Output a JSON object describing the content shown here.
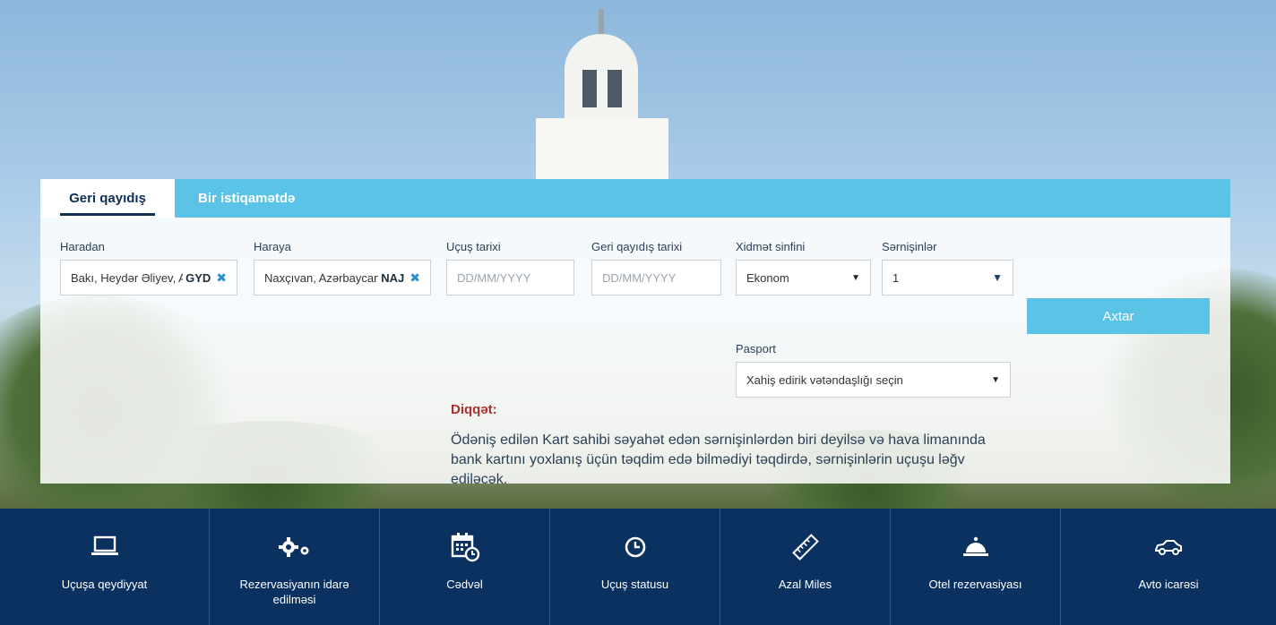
{
  "tabs": {
    "round_trip": "Geri qayıdış",
    "one_way": "Bir istiqamətdə"
  },
  "form": {
    "from": {
      "label": "Haradan",
      "value": "Bakı, Heydər Əliyev, A",
      "code": "GYD"
    },
    "to": {
      "label": "Haraya",
      "value": "Naxçıvan, Azərbaycan",
      "code": "NAJ"
    },
    "departure_date": {
      "label": "Uçuş tarixi",
      "placeholder": "DD/MM/YYYY"
    },
    "return_date": {
      "label": "Geri qayıdış tarixi",
      "placeholder": "DD/MM/YYYY"
    },
    "service_class": {
      "label": "Xidmət sinfini",
      "value": "Ekonom"
    },
    "passengers": {
      "label": "Sərnişinlər",
      "value": "1"
    },
    "search_button": "Axtar",
    "passport": {
      "label": "Pasport",
      "value": "Xahiş edirik vətəndaşlığı seçin"
    }
  },
  "notice": {
    "title": "Diqqət:",
    "text": "Ödəniş edilən Kart sahibi səyahət edən sərnişinlərdən biri deyilsə və hava limanında bank kartını yoxlanış üçün təqdim edə bilmədiyi təqdirdə, sərnişinlərin uçuşu ləğv ediləcək."
  },
  "nav": [
    {
      "label": "Uçuşa qeydiyyat",
      "icon": "laptop-icon"
    },
    {
      "label": "Rezervasiyanın idarə edilməsi",
      "icon": "gears-icon"
    },
    {
      "label": "Cədvəl",
      "icon": "calendar-clock-icon"
    },
    {
      "label": "Uçuş statusu",
      "icon": "clock-icon"
    },
    {
      "label": "Azal Miles",
      "icon": "ruler-icon"
    },
    {
      "label": "Otel rezervasiyası",
      "icon": "service-bell-icon"
    },
    {
      "label": "Avto icarəsi",
      "icon": "car-icon"
    }
  ],
  "colors": {
    "accent": "#5bc3e6",
    "nav_background": "#0a3160",
    "notice_title": "#a73131"
  }
}
